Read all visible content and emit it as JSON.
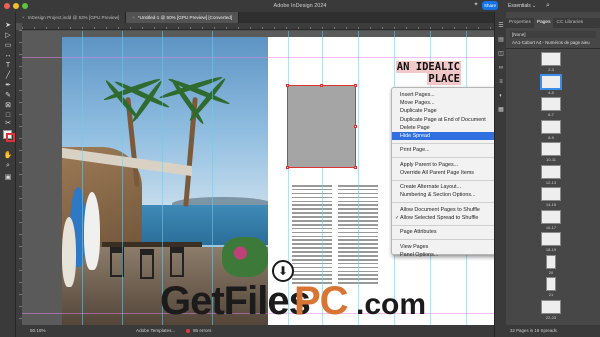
{
  "window": {
    "title": "Adobe InDesign 2024"
  },
  "topbar": {
    "share_label": "Share",
    "workspace_label": "Essentials",
    "workspace_chevron": "⌄"
  },
  "tabs": [
    {
      "label": "InDesign Project.indd @ 53% [GPU Preview]",
      "active": false
    },
    {
      "label": "*Untitled-1 @ 50% [GPU Preview] [Converted]",
      "active": true
    }
  ],
  "document": {
    "headline_line1": "AN IDEALIC",
    "headline_line2": "PLACE"
  },
  "context_menu": {
    "groups": [
      [
        "Insert Pages...",
        "Move Pages...",
        "Duplicate Page",
        "Duplicate Page at End of Document",
        "Delete Page",
        "Hide Spread"
      ],
      [
        "Print Page..."
      ],
      [
        "Apply Parent to Pages...",
        "Override All Parent Page Items"
      ],
      [
        "Create Alternate Layout...",
        "Numbering & Section Options..."
      ],
      [
        "Allow Document Pages to Shuffle",
        "Allow Selected Spread to Shuffle"
      ],
      [
        "Page Attributes"
      ],
      [
        "View Pages",
        "Panel Options..."
      ]
    ],
    "highlighted": "Hide Spread",
    "checked": "Allow Selected Spread to Shuffle",
    "with_submenu": [
      "Page Attributes",
      "View Pages"
    ]
  },
  "status": {
    "zoom": "50.18%",
    "profile": "Adobe Templates...",
    "errors": "86 errors"
  },
  "panel": {
    "tabs": [
      "Properties",
      "Pages",
      "CC Libraries"
    ],
    "active_tab": "Pages",
    "none_label": "[None]",
    "master_label": "AA1-Cabort A4 - Numéros de page aieu",
    "page_numbers": [
      "2-3",
      "4-5",
      "6-7",
      "8-9",
      "10-11",
      "12-13",
      "14-15",
      "16-17",
      "18-19",
      "20",
      "21",
      "22-23"
    ],
    "footer": "32 Pages in 18 Spreads"
  },
  "watermark": {
    "part1": "GetFiles",
    "part2": "PC",
    "part3": ".com"
  },
  "colors": {
    "accent": "#2f6fe0",
    "watermark_orange": "#d87534",
    "headline_bg": "#f2c7c9"
  }
}
